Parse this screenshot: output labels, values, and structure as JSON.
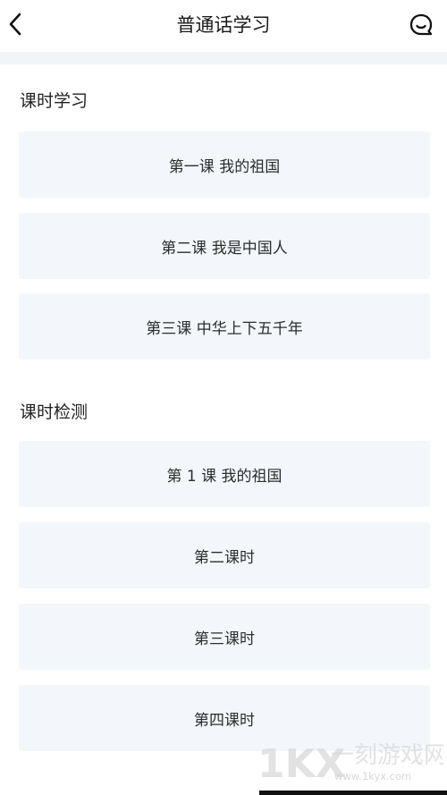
{
  "header": {
    "title": "普通话学习",
    "back_icon": "chevron-left-icon",
    "action_icon": "chat-bubble-icon"
  },
  "sections": [
    {
      "title": "课时学习",
      "items": [
        "第一课 我的祖国",
        "第二课 我是中国人",
        "第三课 中华上下五千年"
      ]
    },
    {
      "title": "课时检测",
      "items": [
        "第 1 课 我的祖国",
        "第二课时",
        "第三课时",
        "第四课时"
      ]
    }
  ],
  "watermark": {
    "logo": "1KX",
    "name": "一刻游戏网",
    "url": "www.1kyx.com"
  },
  "colors": {
    "card_bg": "#f3f7fb",
    "band_bg": "#f1f5f9",
    "text": "#222222"
  }
}
